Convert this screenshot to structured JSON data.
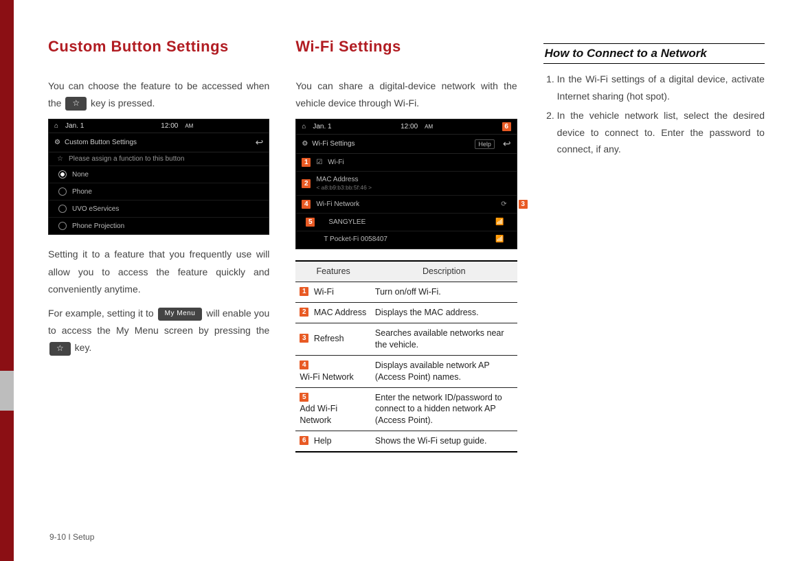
{
  "col1": {
    "heading": "Custom Button Settings",
    "intro_a": "You can choose the feature to be accessed when the ",
    "intro_b": " key is pressed.",
    "shot": {
      "date": "Jan. 1",
      "time": "12:00",
      "ampm": "AM",
      "title": "Custom Button Settings",
      "hint": "Please assign a function to this button",
      "opt1": "None",
      "opt2": "Phone",
      "opt3": "UVO eServices",
      "opt4": "Phone Projection"
    },
    "para2": "Setting it to a feature that you frequently use will allow you to access the feature quickly and conveniently anytime.",
    "para3_a": "For example, setting it to ",
    "mymenu": "My Menu",
    "para3_b": " will enable you to access the My Menu screen by pressing the ",
    "para3_c": " key."
  },
  "col2": {
    "heading": "Wi-Fi Settings",
    "intro": "You can share a digital-device network with the vehicle device through Wi-Fi.",
    "shot": {
      "date": "Jan. 1",
      "time": "12:00",
      "ampm": "AM",
      "title": "Wi-Fi Settings",
      "help": "Help",
      "row1": "Wi-Fi",
      "row2a": "MAC Address",
      "row2b": "< a8:b9:b3:bb:5f:46 >",
      "row3": "Wi-Fi Network",
      "net1": "SANGYLEE",
      "net2": "T Pocket-Fi 0058407",
      "b1": "1",
      "b2": "2",
      "b3": "3",
      "b4": "4",
      "b5": "5",
      "b6": "6"
    },
    "table": {
      "h1": "Features",
      "h2": "Description",
      "r1f": "Wi-Fi",
      "r1d": "Turn on/off Wi-Fi.",
      "r2f": "MAC Address",
      "r2d": "Displays the MAC address.",
      "r3f": "Refresh",
      "r3d": "Searches available networks near the vehicle.",
      "r4f": "Wi-Fi Network",
      "r4d": "Displays available network AP (Access Point) names.",
      "r5f": "Add Wi-Fi Network",
      "r5d": "Enter the network ID/password to connect to a hidden network AP (Access Point).",
      "r6f": "Help",
      "r6d": "Shows the Wi-Fi setup guide."
    }
  },
  "col3": {
    "heading": "How to Connect to a Network",
    "step1": "In the Wi-Fi settings of a digital device, activate Internet sharing (hot spot).",
    "step2": "In the vehicle network list, select the desired device to connect to. Enter the password to connect, if any."
  },
  "footer": "9-10 I Setup",
  "chart_data": {
    "type": "table",
    "title": "Wi-Fi Settings Features",
    "columns": [
      "Features",
      "Description"
    ],
    "rows": [
      [
        "Wi-Fi",
        "Turn on/off Wi-Fi."
      ],
      [
        "MAC Address",
        "Displays the MAC address."
      ],
      [
        "Refresh",
        "Searches available networks near the vehicle."
      ],
      [
        "Wi-Fi Network",
        "Displays available network AP (Access Point) names."
      ],
      [
        "Add Wi-Fi Network",
        "Enter the network ID/password to connect to a hidden network AP (Access Point)."
      ],
      [
        "Help",
        "Shows the Wi-Fi setup guide."
      ]
    ]
  }
}
